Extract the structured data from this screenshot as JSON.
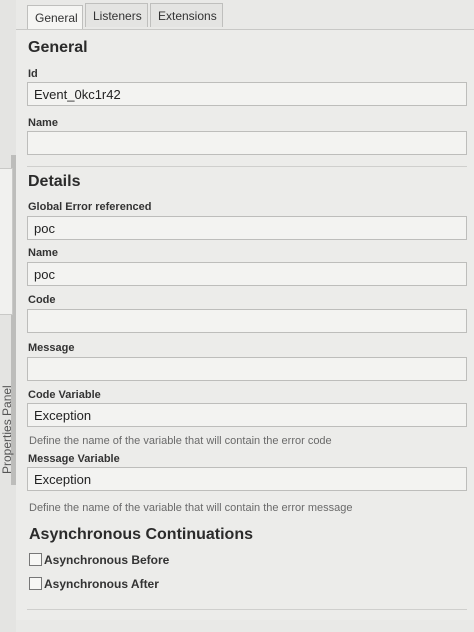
{
  "tabs": [
    "General",
    "Listeners",
    "Extensions"
  ],
  "side_panel_label": "Properties Panel",
  "general": {
    "title": "General",
    "id_label": "Id",
    "id_value": "Event_0kc1r42",
    "name_label": "Name",
    "name_value": ""
  },
  "details": {
    "title": "Details",
    "global_error_label": "Global Error referenced",
    "global_error_value": "poc",
    "name_label": "Name",
    "name_value": "poc",
    "code_label": "Code",
    "code_value": "",
    "message_label": "Message",
    "message_value": "",
    "code_variable_label": "Code Variable",
    "code_variable_value": "Exception",
    "code_variable_hint": "Define the name of the variable that will contain the error code",
    "message_variable_label": "Message Variable",
    "message_variable_value": "Exception",
    "message_variable_hint": "Define the name of the variable that will contain the error message"
  },
  "async": {
    "title": "Asynchronous Continuations",
    "before_label": "Asynchronous Before",
    "after_label": "Asynchronous After"
  }
}
